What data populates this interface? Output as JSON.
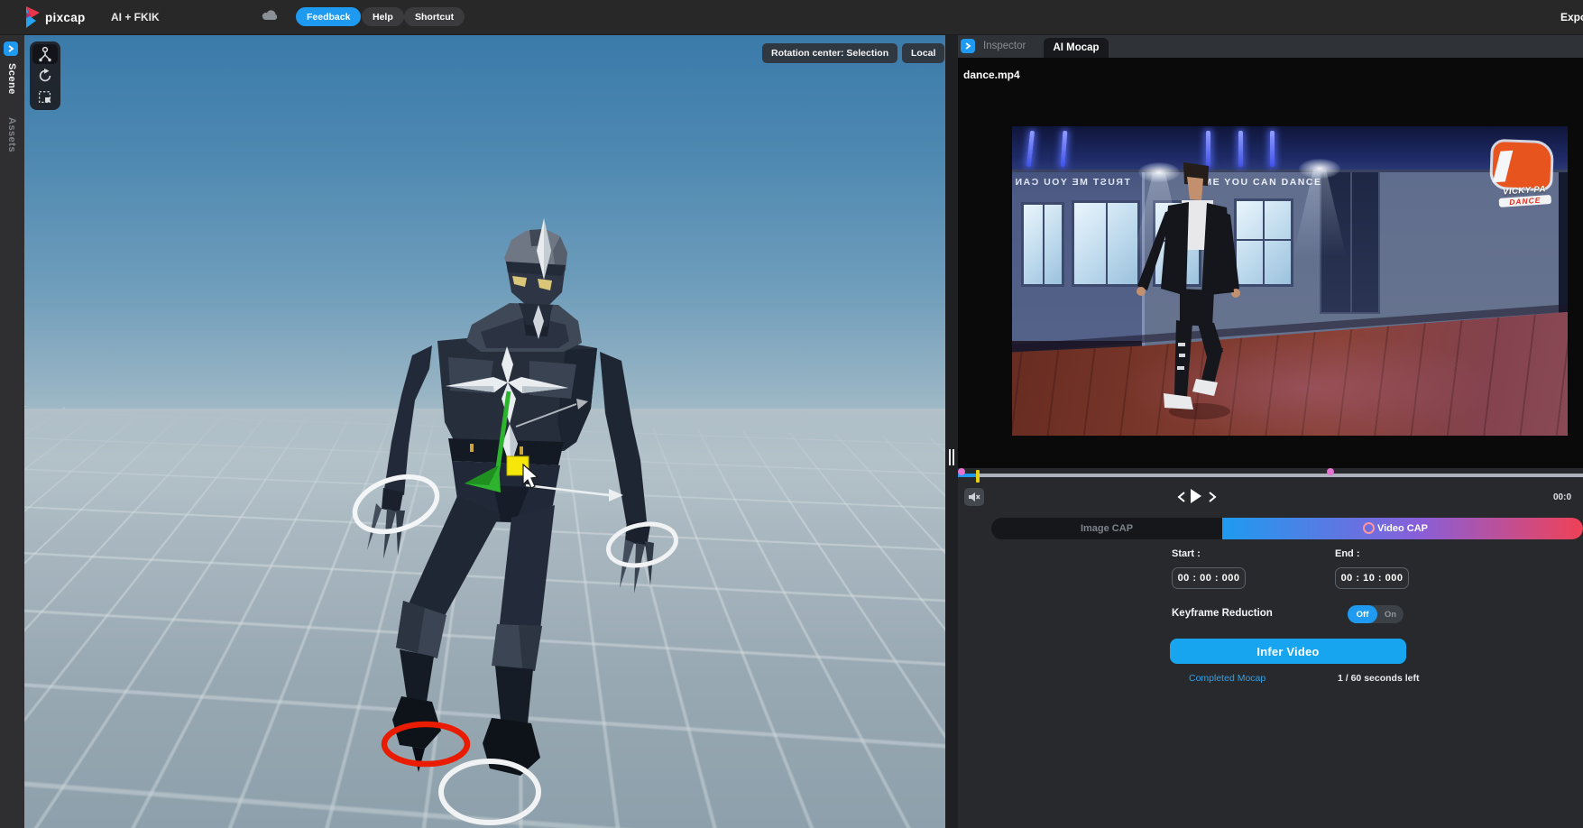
{
  "topbar": {
    "logo_text": "pixcap",
    "project_title": "AI + FKIK",
    "feedback_label": "Feedback",
    "help_label": "Help",
    "shortcut_label": "Shortcut",
    "export_label": "Export",
    "accent_blue": "#1e9bf0"
  },
  "left_sidebar": {
    "tabs": [
      {
        "label": "Scene",
        "active": true
      },
      {
        "label": "Assets",
        "active": false
      }
    ]
  },
  "viewport": {
    "rotation_center_label": "Rotation center: Selection",
    "space_label": "Local",
    "tool_icons": [
      "rig-tool",
      "rotate-tool",
      "scale-tool"
    ],
    "gizmo_colors": {
      "ring_white": "#f0f2f3",
      "ring_red": "#ea1c00",
      "axis_green": "#2db32d",
      "plane_yellow": "#f6e70a"
    }
  },
  "right_panel": {
    "tabs": [
      {
        "label": "Inspector",
        "active": false
      },
      {
        "label": "AI Mocap",
        "active": true
      }
    ],
    "video_filename": "dance.mp4",
    "video_overlay": {
      "wall_text": "T ME YOU CAN DANCE",
      "wall_text_mirrored": "TRUST ME YOU CAN",
      "logo_line1": "VICKY PA",
      "logo_line2": "DANCE"
    },
    "timecode": "00:0",
    "mode_tabs": [
      {
        "label": "Image CAP",
        "active": false
      },
      {
        "label": "Video CAP",
        "active": true
      }
    ],
    "start_label": "Start :",
    "start_value": "00 : 00 : 000",
    "end_label": "End :",
    "end_value": "00 : 10 : 000",
    "keyframe_reduction_label": "Keyframe Reduction",
    "toggle": {
      "off_label": "Off",
      "on_label": "On",
      "selected": "Off"
    },
    "infer_button_label": "Infer Video",
    "completed_link": "Completed Mocap",
    "seconds_left": "1 / 60 seconds left"
  }
}
